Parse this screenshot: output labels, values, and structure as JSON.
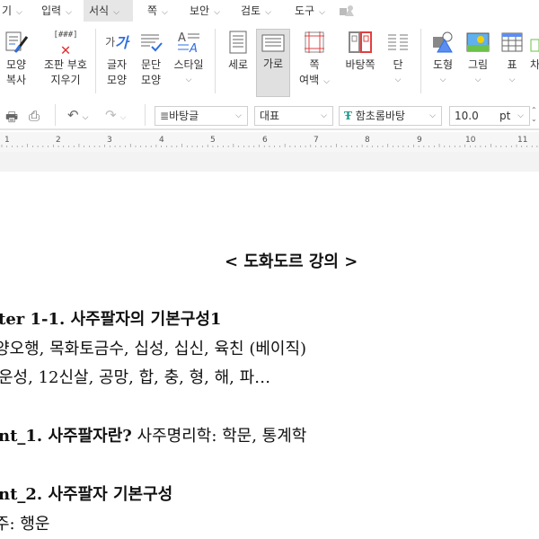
{
  "menu": [
    {
      "label": "기"
    },
    {
      "label": "입력"
    },
    {
      "label": "서식",
      "active": true
    },
    {
      "label": "쪽"
    },
    {
      "label": "보안"
    },
    {
      "label": "검토"
    },
    {
      "label": "도구"
    }
  ],
  "ribbon": {
    "shape_copy": [
      "모양",
      "복사"
    ],
    "clear_markup": [
      "조판 부호",
      "지우기"
    ],
    "char_shape": [
      "글자",
      "모양"
    ],
    "para_shape": [
      "문단",
      "모양"
    ],
    "style": "스타일",
    "portrait": "세로",
    "landscape": "가로",
    "page_margin": [
      "쪽",
      "여백"
    ],
    "master_page": "바탕쪽",
    "columns": "단",
    "shapes": "도형",
    "picture": "그림",
    "table": "표",
    "chart": "차"
  },
  "toolbar": {
    "style": "바탕글",
    "lang": "대표",
    "font": "함초롬바탕",
    "size": "10.0",
    "unit": "pt"
  },
  "ruler": [
    "1",
    "2",
    "3",
    "4",
    "5",
    "6",
    "7",
    "8",
    "9",
    "10",
    "11"
  ],
  "document": {
    "title": "< 도화도르 강의 >",
    "lines": [
      "ter  1-1.  사주팔자의  기본구성1",
      "양오행,  목화토금수,  십성,  십신,  육친  (베이직)",
      "운성,  12신살,  공망,  합,  충,  형,  해,  파…",
      "nt_1.  사주팔자란?",
      " 사주명리학:  학문,  통계학",
      "nt_2.  사주팔자  기본구성",
      "주:  행운"
    ]
  },
  "colors": {
    "accent": "#2f6fe0",
    "active_tab": "#e6e6e6"
  }
}
